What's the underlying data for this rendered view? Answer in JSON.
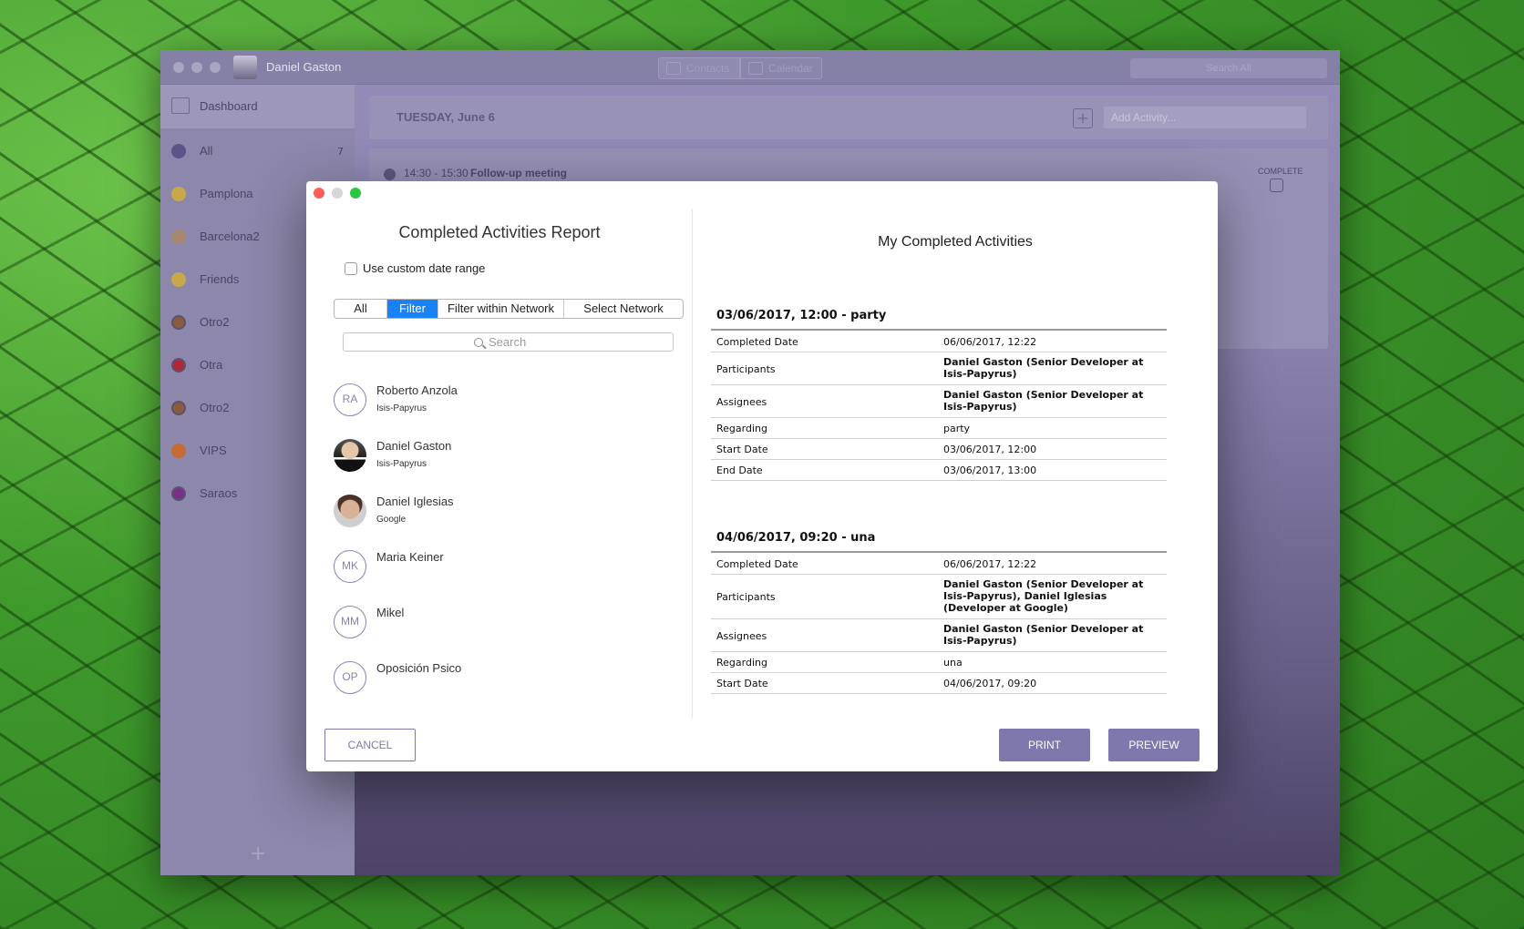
{
  "app": {
    "user_name": "Daniel Gaston",
    "nav": {
      "contacts": "Contacts",
      "calendar": "Calendar"
    },
    "search_placeholder": "Search All"
  },
  "sidebar": {
    "dashboard": "Dashboard",
    "items": [
      {
        "label": "All",
        "count": "7",
        "color": "#5b548a",
        "ring": false
      },
      {
        "label": "Pamplona",
        "count": "",
        "color": "#c9a84a",
        "ring": false
      },
      {
        "label": "Barcelona2",
        "count": "",
        "color": "#a6876e",
        "ring": false
      },
      {
        "label": "Friends",
        "count": "",
        "color": "#c9a84a",
        "ring": false
      },
      {
        "label": "Otro2",
        "count": "",
        "color": "#8c5a3e",
        "ring": true
      },
      {
        "label": "Otra",
        "count": "",
        "color": "#b1273a",
        "ring": true
      },
      {
        "label": "Otro2",
        "count": "",
        "color": "#8c5a3e",
        "ring": true
      },
      {
        "label": "VIPS",
        "count": "",
        "color": "#c76b35",
        "ring": false
      },
      {
        "label": "Saraos",
        "count": "",
        "color": "#7a2f8a",
        "ring": true
      }
    ],
    "add_symbol": "+"
  },
  "main": {
    "day_title": "TUESDAY, June 6",
    "add_symbol": "+",
    "add_activity_placeholder": "Add Activity...",
    "activity": {
      "time": "14:30 - 15:30",
      "title": "Follow-up meeting",
      "complete_label": "COMPLETE"
    }
  },
  "dialog": {
    "report_title": "Completed Activities Report",
    "custom_range_label": "Use custom date range",
    "filter_tabs": [
      {
        "label": "All",
        "active": false
      },
      {
        "label": "Filter",
        "active": true
      },
      {
        "label": "Filter within Network",
        "active": false
      },
      {
        "label": "Select Network",
        "active": false
      }
    ],
    "search_placeholder": "Search",
    "contacts": [
      {
        "initials": "RA",
        "name": "Roberto Anzola",
        "org": "Isis-Papyrus",
        "photo": ""
      },
      {
        "initials": "",
        "name": "Daniel Gaston",
        "org": "Isis-Papyrus",
        "photo": "photo1"
      },
      {
        "initials": "",
        "name": "Daniel Iglesias",
        "org": "Google",
        "photo": "photo2"
      },
      {
        "initials": "MK",
        "name": "Maria Keiner",
        "org": "",
        "photo": ""
      },
      {
        "initials": "MM",
        "name": "Mikel",
        "org": "",
        "photo": ""
      },
      {
        "initials": "OP",
        "name": "Oposición Psico",
        "org": "",
        "photo": ""
      }
    ],
    "preview_title": "My Completed Activities",
    "entries": [
      {
        "heading": "03/06/2017, 12:00 - party",
        "rows": [
          {
            "label": "Completed Date",
            "value": "06/06/2017, 12:22",
            "bold": false
          },
          {
            "label": "Participants",
            "value": "Daniel Gaston (Senior Developer at Isis-Papyrus)",
            "bold": true
          },
          {
            "label": "Assignees",
            "value": "Daniel Gaston (Senior Developer at Isis-Papyrus)",
            "bold": true
          },
          {
            "label": "Regarding",
            "value": "party",
            "bold": false
          },
          {
            "label": "Start Date",
            "value": "03/06/2017, 12:00",
            "bold": false
          },
          {
            "label": "End Date",
            "value": "03/06/2017, 13:00",
            "bold": false
          }
        ]
      },
      {
        "heading": "04/06/2017, 09:20 - una",
        "rows": [
          {
            "label": "Completed Date",
            "value": "06/06/2017, 12:22",
            "bold": false
          },
          {
            "label": "Participants",
            "value": "Daniel Gaston (Senior Developer at Isis-Papyrus), Daniel Iglesias (Developer at Google)",
            "bold": true
          },
          {
            "label": "Assignees",
            "value": "Daniel Gaston (Senior Developer at Isis-Papyrus)",
            "bold": true
          },
          {
            "label": "Regarding",
            "value": "una",
            "bold": false
          },
          {
            "label": "Start Date",
            "value": "04/06/2017, 09:20",
            "bold": false
          }
        ]
      }
    ],
    "buttons": {
      "cancel": "CANCEL",
      "print": "PRINT",
      "preview": "PREVIEW"
    }
  }
}
